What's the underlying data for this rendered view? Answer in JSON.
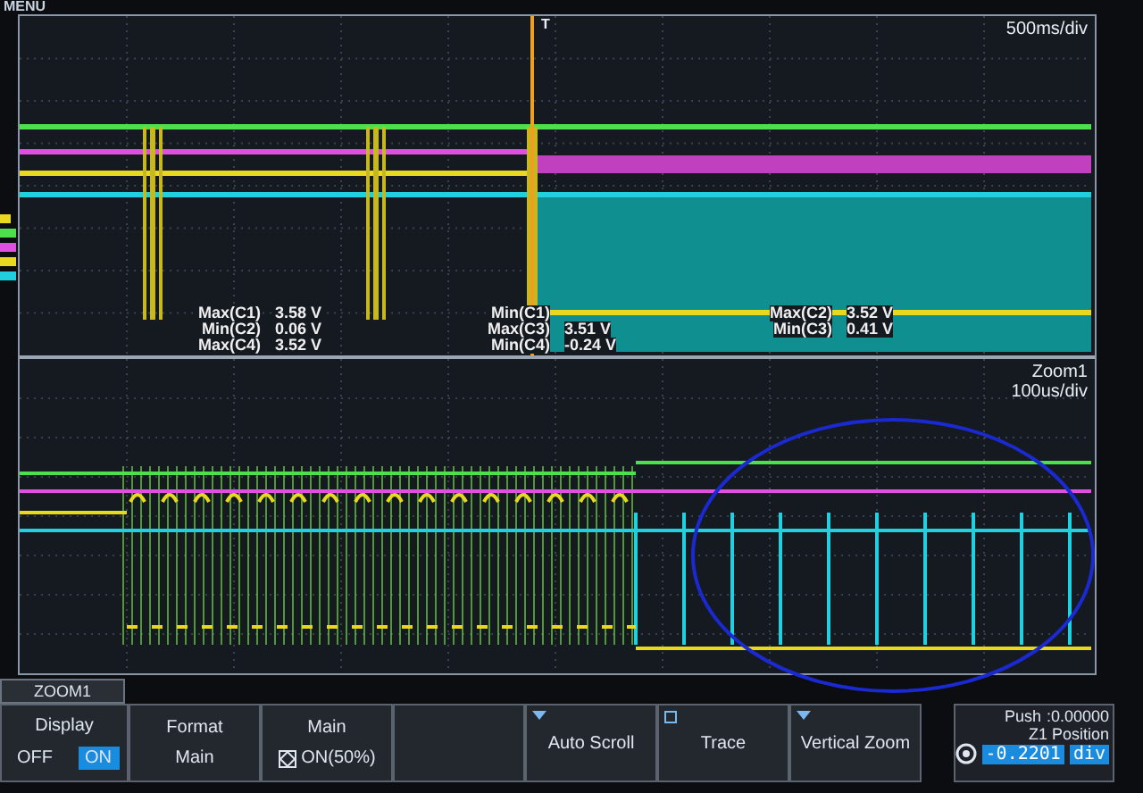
{
  "menu_label": "MENU",
  "main_view": {
    "timebase": "500ms/div",
    "trigger_mark": "T",
    "measurement_columns": [
      [
        {
          "label": "Max(C1)",
          "value": "3.58 V"
        },
        {
          "label": "Min(C2)",
          "value": "0.06 V"
        },
        {
          "label": "Max(C4)",
          "value": "3.52 V"
        }
      ],
      [
        {
          "label": "Min(C1)"
        },
        {
          "label": "Max(C3)",
          "value": "3.51 V"
        },
        {
          "label": "Min(C4)",
          "value": "-0.24 V"
        }
      ],
      [
        {
          "label": "Max(C2)",
          "value": "3.52 V"
        },
        {
          "label": "Min(C3)",
          "value": "0.41 V"
        }
      ]
    ]
  },
  "zoom_view": {
    "title": "Zoom1",
    "timebase": "100us/div"
  },
  "softkey_menu": {
    "title": "ZOOM1",
    "keys": [
      {
        "kind": "toggle",
        "label": "Display",
        "options": [
          {
            "text": "OFF",
            "selected": false
          },
          {
            "text": "ON",
            "selected": true
          }
        ]
      },
      {
        "kind": "value",
        "label": "Format",
        "value": "Main"
      },
      {
        "kind": "icon_value",
        "label": "Main",
        "value": "ON(50%)"
      },
      {
        "kind": "blank"
      },
      {
        "kind": "dropdown",
        "label": "Auto Scroll"
      },
      {
        "kind": "popup",
        "label": "Trace"
      },
      {
        "kind": "dropdown",
        "label": "Vertical Zoom"
      }
    ]
  },
  "knob_panel": {
    "push_hint": "Push",
    "push_value": ":0.00000",
    "label": "Z1 Position",
    "value": "-0.2201",
    "unit": "div"
  }
}
